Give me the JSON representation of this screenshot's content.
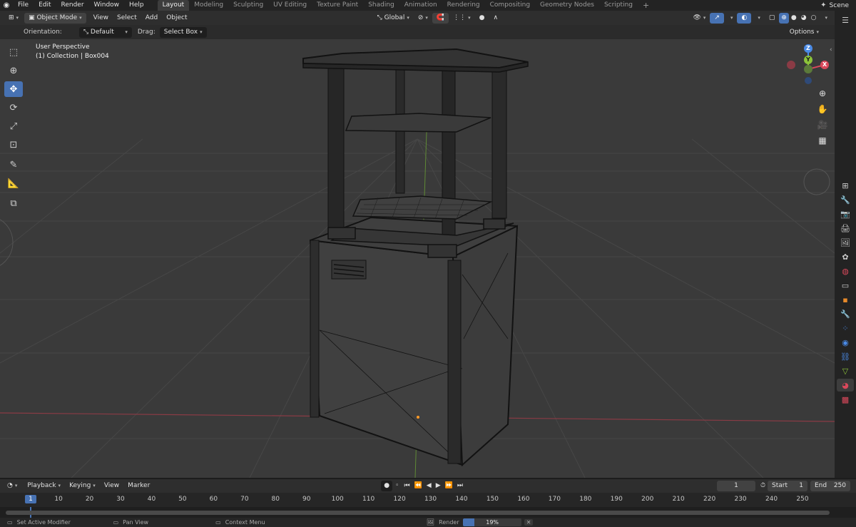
{
  "menus": [
    "File",
    "Edit",
    "Render",
    "Window",
    "Help"
  ],
  "workspaces": [
    "Layout",
    "Modeling",
    "Sculpting",
    "UV Editing",
    "Texture Paint",
    "Shading",
    "Animation",
    "Rendering",
    "Compositing",
    "Geometry Nodes",
    "Scripting"
  ],
  "scene": "Scene",
  "header": {
    "mode": "Object Mode",
    "view": "View",
    "select": "Select",
    "add": "Add",
    "object": "Object",
    "transform": "Global",
    "orientation_label": "Orientation:",
    "orientation_value": "Default",
    "drag_label": "Drag:",
    "drag_value": "Select Box",
    "options": "Options"
  },
  "viewport": {
    "perspective": "User Perspective",
    "collection": "(1) Collection | Box004"
  },
  "gizmo": {
    "z": "Z",
    "y": "Y",
    "x": "X"
  },
  "timeline": {
    "playback": "Playback",
    "keying": "Keying",
    "view": "View",
    "marker": "Marker",
    "current_frame": "1",
    "start_label": "Start",
    "start": "1",
    "end_label": "End",
    "end": "250",
    "ticks": [
      "1",
      "10",
      "20",
      "30",
      "40",
      "50",
      "60",
      "70",
      "80",
      "90",
      "100",
      "110",
      "120",
      "130",
      "140",
      "150",
      "160",
      "170",
      "180",
      "190",
      "200",
      "210",
      "220",
      "230",
      "240",
      "250"
    ]
  },
  "status": {
    "left": "Set Active Modifier",
    "middle": "Pan View",
    "right": "Context Menu",
    "render": "Render",
    "progress": "19%",
    "progress_fraction": 0.19
  },
  "colors": {
    "accent": "#4772b3",
    "x_axis": "#d9485b",
    "y_axis": "#8cc43a",
    "z_axis": "#4a8ae6",
    "viewport_bg": "#3a3a3a"
  }
}
